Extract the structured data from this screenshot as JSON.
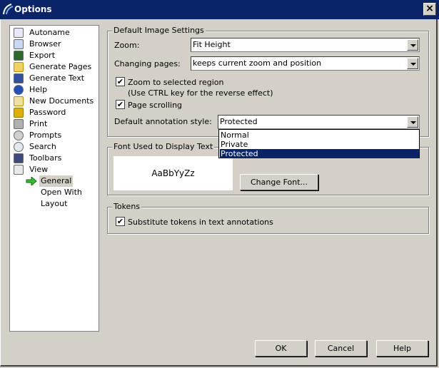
{
  "window": {
    "title": "Options",
    "close_glyph": "×"
  },
  "tree": {
    "items": [
      {
        "label": "Autoname",
        "icon": "autoname-icon"
      },
      {
        "label": "Browser",
        "icon": "browser-icon"
      },
      {
        "label": "Export",
        "icon": "export-icon"
      },
      {
        "label": "Generate Pages",
        "icon": "generate-pages-icon"
      },
      {
        "label": "Generate Text",
        "icon": "generate-text-icon"
      },
      {
        "label": "Help",
        "icon": "help-icon"
      },
      {
        "label": "New Documents",
        "icon": "new-documents-icon"
      },
      {
        "label": "Password",
        "icon": "key-icon"
      },
      {
        "label": "Print",
        "icon": "printer-icon"
      },
      {
        "label": "Prompts",
        "icon": "question-icon"
      },
      {
        "label": "Search",
        "icon": "search-icon"
      },
      {
        "label": "Toolbars",
        "icon": "toolbars-icon"
      },
      {
        "label": "View",
        "icon": "view-icon"
      }
    ],
    "children": [
      {
        "label": "General",
        "selected": true
      },
      {
        "label": "Open With"
      },
      {
        "label": "Layout"
      }
    ]
  },
  "image_settings": {
    "legend": "Default Image Settings",
    "zoom_label": "Zoom:",
    "zoom_value": "Fit Height",
    "changing_pages_label": "Changing pages:",
    "changing_pages_value": "keeps current zoom and position",
    "zoom_region_label": "Zoom to selected region",
    "zoom_region_note": "(Use CTRL key for the reverse effect)",
    "zoom_region_checked": true,
    "page_scrolling_label": "Page scrolling",
    "page_scrolling_checked": true,
    "annotation_style_label": "Default annotation style:",
    "annotation_style_value": "Protected",
    "annotation_options": [
      "Normal",
      "Private",
      "Protected"
    ],
    "check_glyph": "✔"
  },
  "font_group": {
    "legend": "Font Used to Display Text",
    "sample": "AaBbYyZz",
    "change_font_label": "Change Font..."
  },
  "tokens_group": {
    "legend": "Tokens",
    "substitute_label": "Substitute tokens in text annotations",
    "substitute_checked": true
  },
  "footer": {
    "ok_label": "OK",
    "cancel_label": "Cancel",
    "help_label": "Help"
  }
}
